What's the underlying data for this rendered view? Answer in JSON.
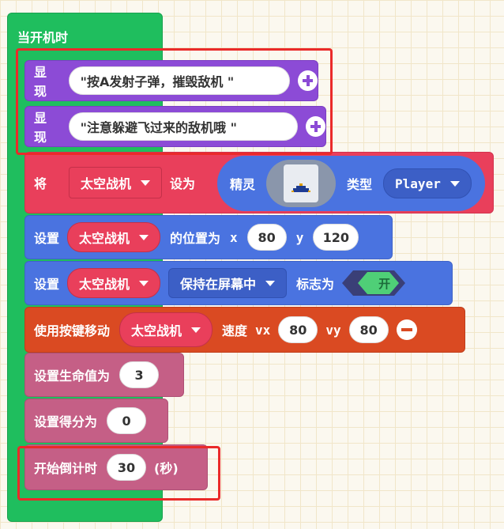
{
  "hat": {
    "title": "当开机时"
  },
  "show1": {
    "label": "显现",
    "text": "\"按A发射子弹，摧毁敌机 \""
  },
  "show2": {
    "label": "显现",
    "text": "\"注意躲避飞过来的敌机哦 \""
  },
  "set_sprite": {
    "label_set": "将",
    "var": "太空战机",
    "label_as": "设为",
    "label_sprite": "精灵",
    "label_kind": "类型",
    "kind": "Player"
  },
  "set_pos": {
    "label": "设置",
    "var": "太空战机",
    "label_pos": "的位置为",
    "x_label": "x",
    "x": "80",
    "y_label": "y",
    "y": "120"
  },
  "stay": {
    "label": "设置",
    "var": "太空战机",
    "flag": "保持在屏幕中",
    "label_flag": "标志为",
    "toggle": "开"
  },
  "move": {
    "label": "使用按键移动",
    "var": "太空战机",
    "label_speed": "速度",
    "vx_label": "vx",
    "vx": "80",
    "vy_label": "vy",
    "vy": "80"
  },
  "life": {
    "label": "设置生命值为",
    "value": "3"
  },
  "score": {
    "label": "设置得分为",
    "value": "0"
  },
  "countdown": {
    "label": "开始倒计时",
    "value": "30",
    "unit": "(秒)"
  },
  "colors": {
    "hat": "#1fbe5e",
    "looks": "#8c4bd6",
    "sprites": "#e93f5b",
    "sprite_blue": "#4a73e0",
    "controller": "#da4a22",
    "info": "#c55f86",
    "highlight": "#ea2a2a"
  },
  "icons": [
    "plus-icon",
    "minus-icon",
    "dropdown-caret-icon",
    "sprite-image-icon"
  ]
}
